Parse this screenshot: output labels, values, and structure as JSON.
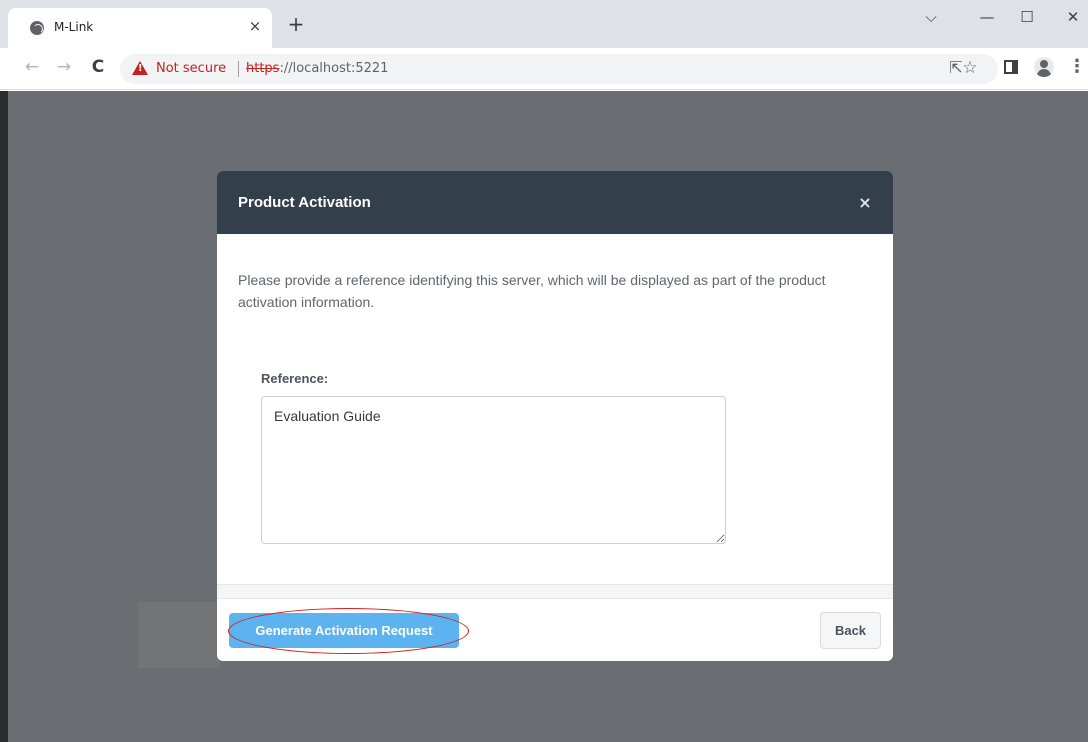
{
  "browser": {
    "tab_title": "M-Link",
    "tab_close_glyph": "×",
    "new_tab_glyph": "+",
    "window_controls": {
      "dropdown": "⌵",
      "minimize": "—",
      "maximize": "☐",
      "close": "✕"
    },
    "nav": {
      "back": "←",
      "forward": "→",
      "reload": "C"
    },
    "security_label": "Not secure",
    "url_scheme": "https",
    "url_rest": "://localhost:5221",
    "icons": [
      "globe-icon",
      "warning-icon",
      "share-icon",
      "star-icon",
      "side-panel-icon",
      "profile-icon",
      "more-icon"
    ],
    "toolbar_glyphs": {
      "share": "⇱",
      "star": "☆",
      "menu": "⋮"
    }
  },
  "modal": {
    "title": "Product Activation",
    "close_glyph": "×",
    "description": "Please provide a reference identifying this server, which will be displayed as part of the product activation information.",
    "reference_label": "Reference:",
    "reference_value": "Evaluation Guide",
    "generate_button": "Generate Activation Request",
    "back_button": "Back"
  },
  "colors": {
    "modal_header": "#343f4c",
    "primary_button": "#5cb3f0",
    "overlay": "#6a6d71",
    "warning": "#c5221f",
    "highlight": "#cc1f1f"
  }
}
